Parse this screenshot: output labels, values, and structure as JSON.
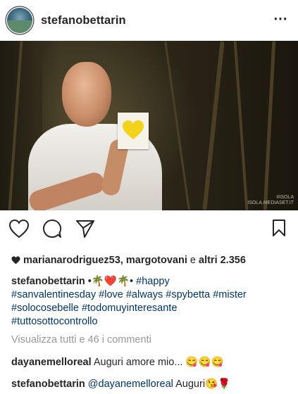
{
  "post": {
    "author": "stefanobettarin",
    "more_icon": "⋯",
    "watermark_line1": "#ISOLA",
    "watermark_line2": "ISOLA.MEDIASET.IT"
  },
  "likes": {
    "prefix_bold": "marianarodriguez53, margotovani",
    "connector": " e ",
    "suffix_bold": "altri 2.356"
  },
  "caption": {
    "username": "stefanobettarin",
    "emojis": " •🌴❤️🌴• ",
    "hashtags": [
      "#happy",
      "#sanvalentinesday",
      "#love",
      "#always",
      "#spybetta",
      "#mister",
      "#solocosebelle",
      "#todomuyinteresante",
      "#tuttosottocontrollo"
    ]
  },
  "view_all": "Visualizza tutti e 46 i commenti",
  "comments": [
    {
      "username": "dayanemelloreal",
      "text": " Auguri amore mio... 😋😋😋"
    },
    {
      "username": "stefanobettarin",
      "mention": "@dayanemelloreal",
      "text": " Auguri😘🌹"
    }
  ],
  "colors": {
    "hashtag": "#003569",
    "muted": "#999999",
    "text": "#262626",
    "heart_card": "#f2d21a"
  }
}
